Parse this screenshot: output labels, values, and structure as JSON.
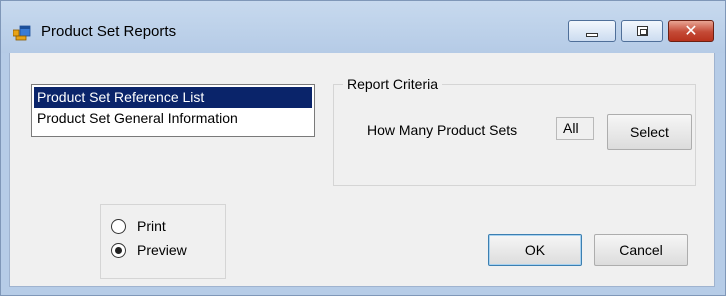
{
  "window": {
    "title": "Product Set Reports",
    "icon": "app-window-icon",
    "close_color": "#c44a36",
    "selection_color": "#0a246a"
  },
  "reports_list": {
    "items": [
      {
        "label": "Product Set Reference List",
        "selected": true
      },
      {
        "label": "Product Set General Information",
        "selected": false
      }
    ]
  },
  "report_criteria": {
    "legend": "Report Criteria",
    "how_many_label": "How Many Product Sets",
    "how_many_value": "All",
    "select_label": "Select"
  },
  "output": {
    "options": [
      {
        "label": "Print",
        "checked": false
      },
      {
        "label": "Preview",
        "checked": true
      }
    ]
  },
  "buttons": {
    "ok_label": "OK",
    "cancel_label": "Cancel"
  }
}
